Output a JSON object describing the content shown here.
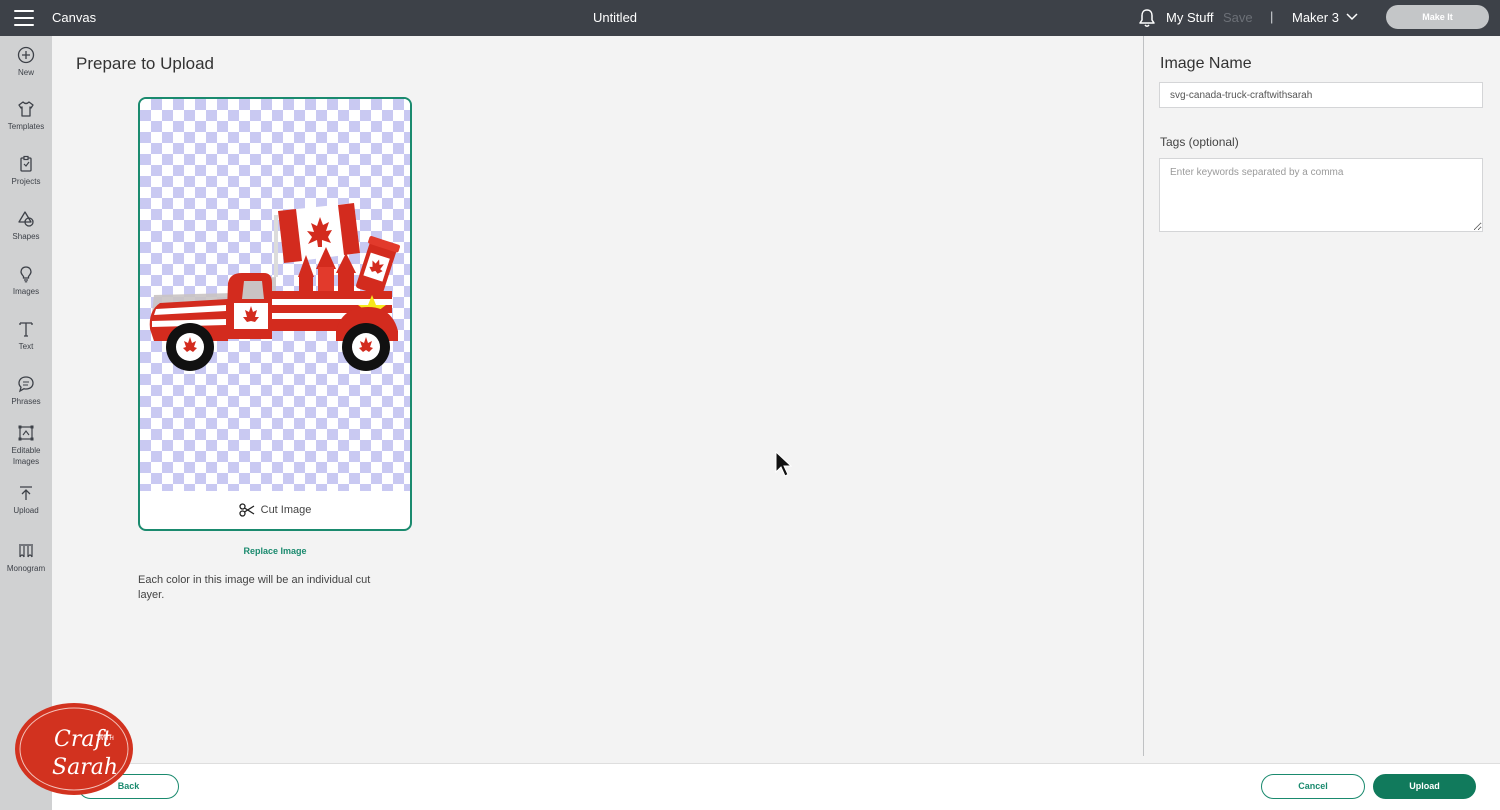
{
  "topbar": {
    "app_name": "Canvas",
    "document_title": "Untitled",
    "my_stuff_label": "My Stuff",
    "save_label": "Save",
    "separator": "|",
    "machine_label": "Maker 3",
    "make_it_label": "Make It"
  },
  "leftnav": {
    "items": [
      {
        "label": "New",
        "icon": "plus-circle-icon"
      },
      {
        "label": "Templates",
        "icon": "shirt-icon"
      },
      {
        "label": "Projects",
        "icon": "clipboard-icon"
      },
      {
        "label": "Shapes",
        "icon": "shapes-icon"
      },
      {
        "label": "Images",
        "icon": "lightbulb-icon"
      },
      {
        "label": "Text",
        "icon": "text-icon"
      },
      {
        "label": "Phrases",
        "icon": "speech-bubble-icon"
      },
      {
        "label": "Editable Images",
        "icon": "editable-image-icon"
      },
      {
        "label": "Upload",
        "icon": "upload-icon"
      },
      {
        "label": "Monogram",
        "icon": "monogram-icon"
      }
    ]
  },
  "main": {
    "title": "Prepare to Upload",
    "cut_image_label": "Cut Image",
    "replace_image_label": "Replace Image",
    "info_text": "Each color in this image will be an individual cut layer."
  },
  "right_panel": {
    "image_name_label": "Image Name",
    "image_name_value": "svg-canada-truck-craftwithsarah",
    "tags_label": "Tags (optional)",
    "tags_placeholder": "Enter keywords separated by a comma"
  },
  "bottombar": {
    "back_label": "Back",
    "cancel_label": "Cancel",
    "upload_label": "Upload"
  },
  "colors": {
    "topbar_bg": "#3d4148",
    "accent_green": "#1a8a6e",
    "upload_green": "#117a5c",
    "logo_red": "#d2321f"
  }
}
